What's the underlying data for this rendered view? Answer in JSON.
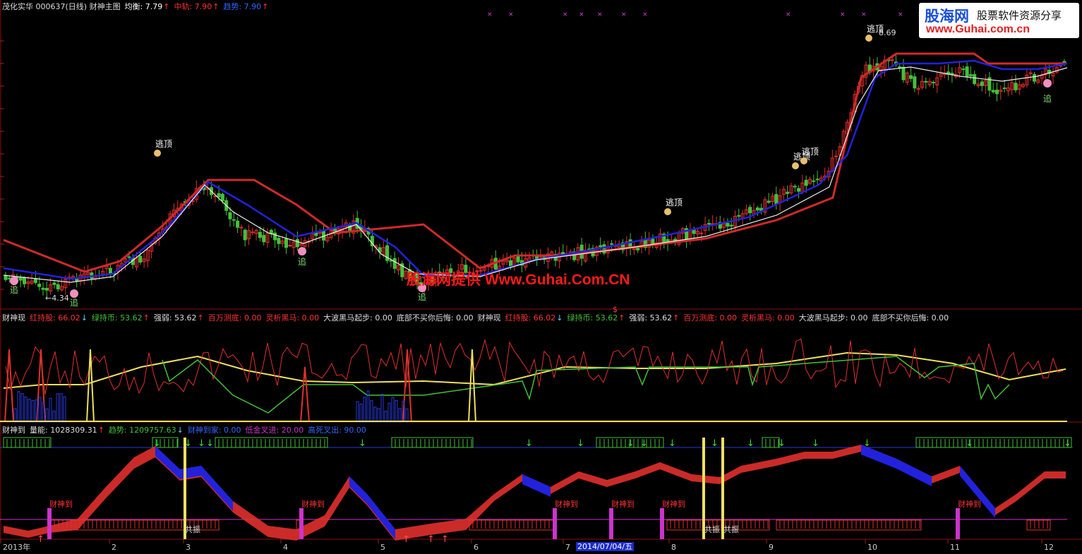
{
  "colors": {
    "bg": "#000000",
    "up": "#e0302c",
    "down": "#44c03a",
    "blue": "#2222dd",
    "white": "#eeeeee",
    "yellow": "#f0e060",
    "magenta": "#cc33cc",
    "sep": "#8b1010",
    "gridRed": "#5a0a0a"
  },
  "logo": {
    "brand": "股海网",
    "tagline": "股票软件资源分享",
    "url": "www.Guhai.com.cn"
  },
  "watermark": "股海网提供 Www.Guhai.Com.CN",
  "panel1": {
    "legend": [
      {
        "text": "茂化实华 000637(日线) 财神主图",
        "color": "#dddddd"
      },
      {
        "text": "均衡: 7.79",
        "color": "#ffffff",
        "arrow": "↑"
      },
      {
        "text": "中轨: 7.90",
        "color": "#ff3333",
        "arrow": "↑"
      },
      {
        "text": "趋势: 7.90",
        "color": "#3366ff",
        "arrow": "↑"
      }
    ],
    "labels": {
      "escape": "逃顶",
      "chase": "追",
      "low": "←4.34",
      "high": "8.69",
      "cursor": "$"
    }
  },
  "panel2": {
    "legend": [
      {
        "text": "财神现",
        "color": "#dddddd"
      },
      {
        "text": "红持股: 66.02",
        "color": "#ff3333",
        "arrow": "↓"
      },
      {
        "text": "绿持币: 53.62",
        "color": "#44c03a",
        "arrow": "↑"
      },
      {
        "text": "强弱: 53.62",
        "color": "#dddddd",
        "arrow": "↑"
      },
      {
        "text": "百万测底: 0.00",
        "color": "#ff3333"
      },
      {
        "text": "灵析黑马: 0.00",
        "color": "#ff3333"
      },
      {
        "text": "大波黑马起步: 0.00",
        "color": "#dddddd"
      },
      {
        "text": "底部不买你后悔: 0.00",
        "color": "#dddddd"
      },
      {
        "text": "财神现",
        "color": "#dddddd"
      },
      {
        "text": "红持股: 66.02",
        "color": "#ff3333",
        "arrow": "↓"
      },
      {
        "text": "绿持币: 53.62",
        "color": "#44c03a",
        "arrow": "↑"
      },
      {
        "text": "强弱: 53.62",
        "color": "#dddddd",
        "arrow": "↑"
      },
      {
        "text": "百万测底: 0.00",
        "color": "#ff3333"
      },
      {
        "text": "灵析黑马: 0.00",
        "color": "#ff3333"
      },
      {
        "text": "大波黑马起步: 0.00",
        "color": "#dddddd"
      },
      {
        "text": "底部不买你后悔: 0.00",
        "color": "#dddddd"
      }
    ]
  },
  "panel3": {
    "legend": [
      {
        "text": "财神到",
        "color": "#dddddd"
      },
      {
        "text": "量能: 1028309.31",
        "color": "#dddddd",
        "arrow": "↑"
      },
      {
        "text": "趋势: 1209757.63",
        "color": "#44c03a",
        "arrow": "↓"
      },
      {
        "text": "财神到家: 0.00",
        "color": "#3366ff"
      },
      {
        "text": "低金叉进: 20.00",
        "color": "#cc33cc"
      },
      {
        "text": "高死叉出: 90.00",
        "color": "#3366ff"
      }
    ],
    "labels": {
      "arrive": "财神到",
      "resonance": "共振"
    }
  },
  "xaxis": {
    "ticks": [
      "2013年",
      "2",
      "3",
      "4",
      "5",
      "6",
      "7",
      "8",
      "9",
      "10",
      "11",
      "12"
    ],
    "cursor_date": "2014/07/04/五"
  },
  "chart_data": [
    {
      "type": "candlestick",
      "title": "茂化实华 000637(日线) 财神主图",
      "series": [
        {
          "name": "均衡",
          "last": 7.79
        },
        {
          "name": "中轨",
          "last": 7.9
        },
        {
          "name": "趋势",
          "last": 7.9
        }
      ],
      "annotations": [
        {
          "text": "8.69",
          "kind": "high"
        },
        {
          "text": "←4.34",
          "kind": "low"
        }
      ],
      "legend": "top-left"
    },
    {
      "type": "line",
      "title": "财神现",
      "series": [
        {
          "name": "红持股",
          "last": 66.02
        },
        {
          "name": "绿持币",
          "last": 53.62
        },
        {
          "name": "强弱",
          "last": 53.62
        },
        {
          "name": "百万测底",
          "last": 0.0
        },
        {
          "name": "灵析黑马",
          "last": 0.0
        },
        {
          "name": "大波黑马起步",
          "last": 0.0
        },
        {
          "name": "底部不买你后悔",
          "last": 0.0
        }
      ],
      "legend": "top-left"
    },
    {
      "type": "area",
      "title": "财神到",
      "series": [
        {
          "name": "量能",
          "last": 1028309.31
        },
        {
          "name": "趋势",
          "last": 1209757.63
        },
        {
          "name": "财神到家",
          "last": 0.0
        },
        {
          "name": "低金叉进",
          "last": 20.0
        },
        {
          "name": "高死叉出",
          "last": 90.0
        }
      ],
      "legend": "top-left"
    }
  ]
}
